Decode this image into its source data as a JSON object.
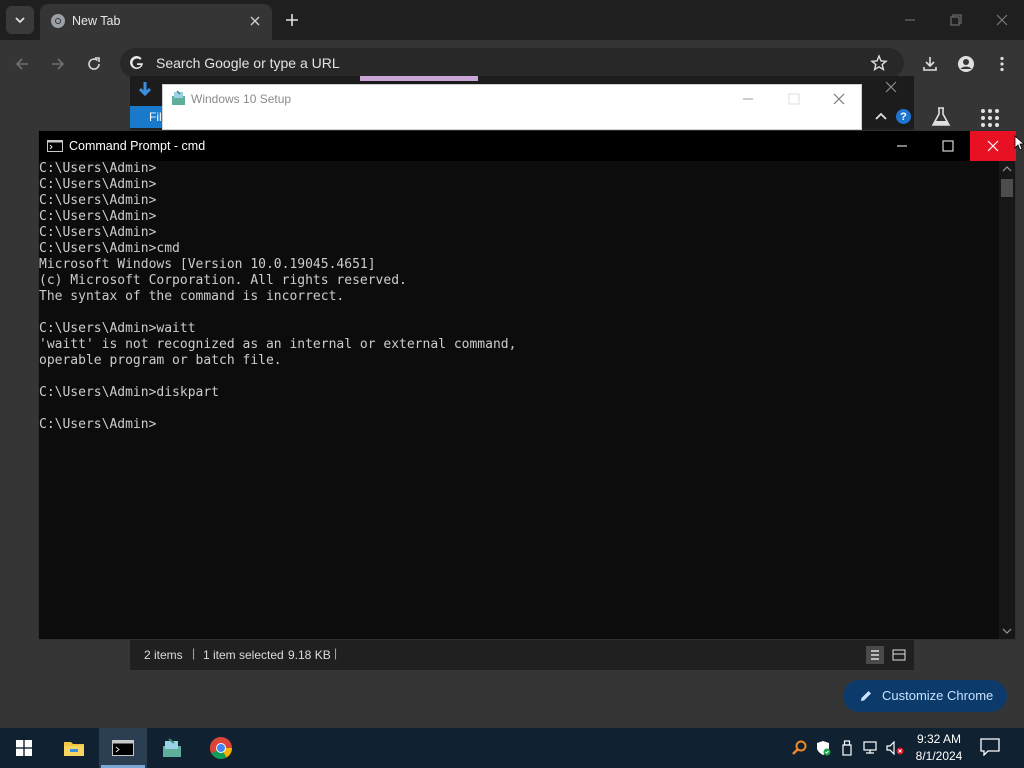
{
  "chrome": {
    "tab_title": "New Tab",
    "omnibox_placeholder": "Search Google or type a URL",
    "customize_label": "Customize Chrome"
  },
  "explorer": {
    "file_tab_label": "File",
    "status": {
      "items": "2 items",
      "selected": "1 item selected",
      "size": "9.18 KB",
      "separator": "|"
    }
  },
  "setup_window": {
    "title": "Windows 10 Setup"
  },
  "cmd": {
    "title": "Command Prompt - cmd",
    "lines": [
      "C:\\Users\\Admin>",
      "C:\\Users\\Admin>",
      "C:\\Users\\Admin>",
      "C:\\Users\\Admin>",
      "C:\\Users\\Admin>",
      "C:\\Users\\Admin>cmd",
      "Microsoft Windows [Version 10.0.19045.4651]",
      "(c) Microsoft Corporation. All rights reserved.",
      "The syntax of the command is incorrect.",
      "",
      "C:\\Users\\Admin>waitt",
      "'waitt' is not recognized as an internal or external command,",
      "operable program or batch file.",
      "",
      "C:\\Users\\Admin>diskpart",
      "",
      "C:\\Users\\Admin>"
    ]
  },
  "taskbar": {
    "time": "9:32 AM",
    "date": "8/1/2024"
  },
  "colors": {
    "close_red": "#e81123",
    "taskbar_bg": "#102131",
    "customize_bg": "#0b3a6b"
  }
}
